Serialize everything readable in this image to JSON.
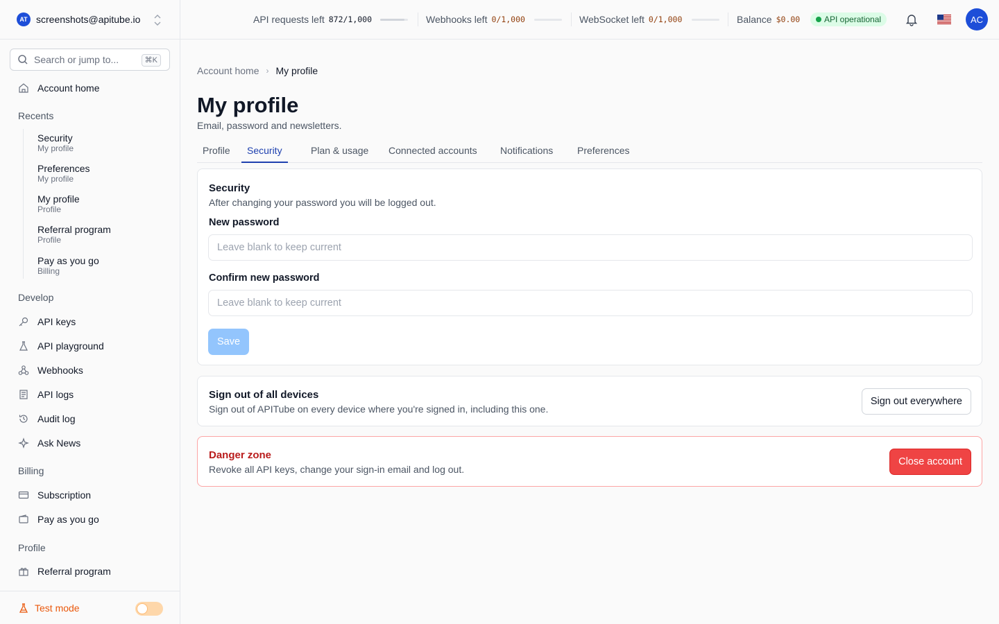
{
  "account": {
    "logo_text": "AT",
    "email": "screenshots@apitube.io"
  },
  "search": {
    "placeholder": "Search or jump to...",
    "shortcut": "⌘K"
  },
  "sidebar": {
    "home": {
      "label": "Account home",
      "icon": "home-icon"
    },
    "recents_title": "Recents",
    "recents": [
      {
        "title": "Security",
        "subtitle": "My profile"
      },
      {
        "title": "Preferences",
        "subtitle": "My profile"
      },
      {
        "title": "My profile",
        "subtitle": "Profile"
      },
      {
        "title": "Referral program",
        "subtitle": "Profile"
      },
      {
        "title": "Pay as you go",
        "subtitle": "Billing"
      }
    ],
    "develop_title": "Develop",
    "develop": [
      {
        "label": "API keys",
        "icon": "key-icon"
      },
      {
        "label": "API playground",
        "icon": "flask-icon"
      },
      {
        "label": "Webhooks",
        "icon": "webhook-icon"
      },
      {
        "label": "API logs",
        "icon": "logs-icon"
      },
      {
        "label": "Audit log",
        "icon": "history-icon"
      },
      {
        "label": "Ask News",
        "icon": "sparkle-icon"
      }
    ],
    "billing_title": "Billing",
    "billing": [
      {
        "label": "Subscription",
        "icon": "card-icon"
      },
      {
        "label": "Pay as you go",
        "icon": "wallet-icon"
      }
    ],
    "profile_title": "Profile",
    "profile": [
      {
        "label": "Referral program",
        "icon": "gift-icon"
      }
    ],
    "test_mode": {
      "label": "Test mode",
      "enabled": false
    }
  },
  "topbar": {
    "api_requests": {
      "label": "API requests left",
      "value": "872/1,000",
      "fraction": 0.872
    },
    "webhooks": {
      "label": "Webhooks left",
      "value": "0/1,000",
      "fraction": 0
    },
    "websocket": {
      "label": "WebSocket left",
      "value": "0/1,000",
      "fraction": 0
    },
    "balance": {
      "label": "Balance",
      "value": "$0.00"
    },
    "status": "API operational",
    "avatar_initials": "AC",
    "colors": {
      "accent": "#1e40af",
      "warn_value": "#92400e",
      "status_bg": "#dcfce7",
      "danger": "#ef4444"
    }
  },
  "breadcrumb": {
    "parent": "Account home",
    "current": "My profile"
  },
  "page": {
    "title": "My profile",
    "subtitle": "Email, password and newsletters."
  },
  "tabs": [
    {
      "label": "Profile",
      "active": false
    },
    {
      "label": "Security",
      "active": true
    },
    {
      "label": "Plan & usage",
      "active": false
    },
    {
      "label": "Connected accounts",
      "active": false
    },
    {
      "label": "Notifications",
      "active": false
    },
    {
      "label": "Preferences",
      "active": false
    }
  ],
  "security": {
    "title": "Security",
    "description": "After changing your password you will be logged out.",
    "new_password_label": "New password",
    "new_password_placeholder": "Leave blank to keep current",
    "confirm_password_label": "Confirm new password",
    "confirm_password_placeholder": "Leave blank to keep current",
    "save_label": "Save"
  },
  "signout": {
    "title": "Sign out of all devices",
    "description": "Sign out of APITube on every device where you're signed in, including this one.",
    "button_label": "Sign out everywhere"
  },
  "danger": {
    "title": "Danger zone",
    "description": "Revoke all API keys, change your sign-in email and log out.",
    "button_label": "Close account"
  }
}
